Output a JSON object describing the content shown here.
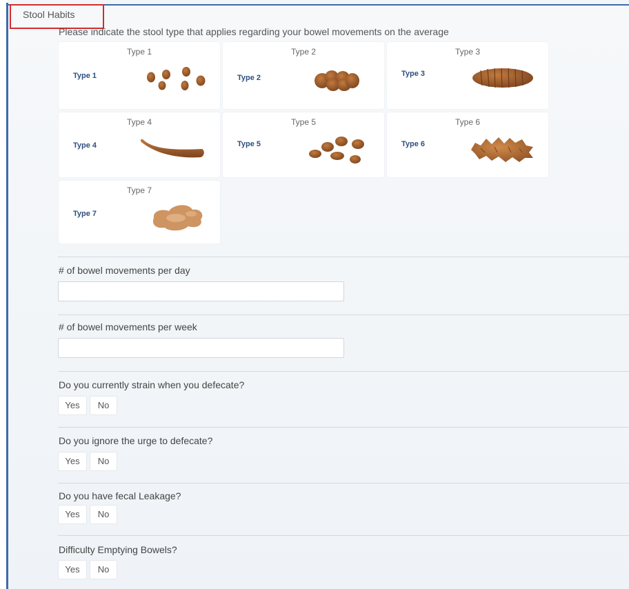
{
  "section": {
    "title": "Stool Habits"
  },
  "stool_type": {
    "prompt": "Please indicate the stool type that applies regarding your bowel movements on the average",
    "types": [
      {
        "title": "Type 1",
        "label": "Type 1",
        "image_icon": "separate-hard-lumps-icon"
      },
      {
        "title": "Type 2",
        "label": "Type 2",
        "image_icon": "lumpy-sausage-icon"
      },
      {
        "title": "Type 3",
        "label": "Type 3",
        "image_icon": "cracked-sausage-icon"
      },
      {
        "title": "Type 4",
        "label": "Type 4",
        "image_icon": "smooth-sausage-icon"
      },
      {
        "title": "Type 5",
        "label": "Type 5",
        "image_icon": "soft-blobs-icon"
      },
      {
        "title": "Type 6",
        "label": "Type 6",
        "image_icon": "mushy-pieces-icon"
      },
      {
        "title": "Type 7",
        "label": "Type 7",
        "image_icon": "liquid-puddle-icon"
      }
    ]
  },
  "movements_per_day": {
    "label": "# of bowel movements per day",
    "value": "",
    "placeholder": ""
  },
  "movements_per_week": {
    "label": "# of bowel movements per week",
    "value": "",
    "placeholder": ""
  },
  "questions": [
    {
      "label": "Do you currently strain when you defecate?",
      "yes": "Yes",
      "no": "No"
    },
    {
      "label": "Do you ignore the urge to defecate?",
      "yes": "Yes",
      "no": "No"
    },
    {
      "label": "Do you have fecal Leakage?",
      "yes": "Yes",
      "no": "No"
    },
    {
      "label": "Difficulty Emptying Bowels?",
      "yes": "Yes",
      "no": "No"
    }
  ],
  "colors": {
    "accent_border": "#3c6aa7",
    "highlight_box": "#d42b2b",
    "type_label": "#2f4f7f",
    "stool_brown": "#a0612c"
  }
}
